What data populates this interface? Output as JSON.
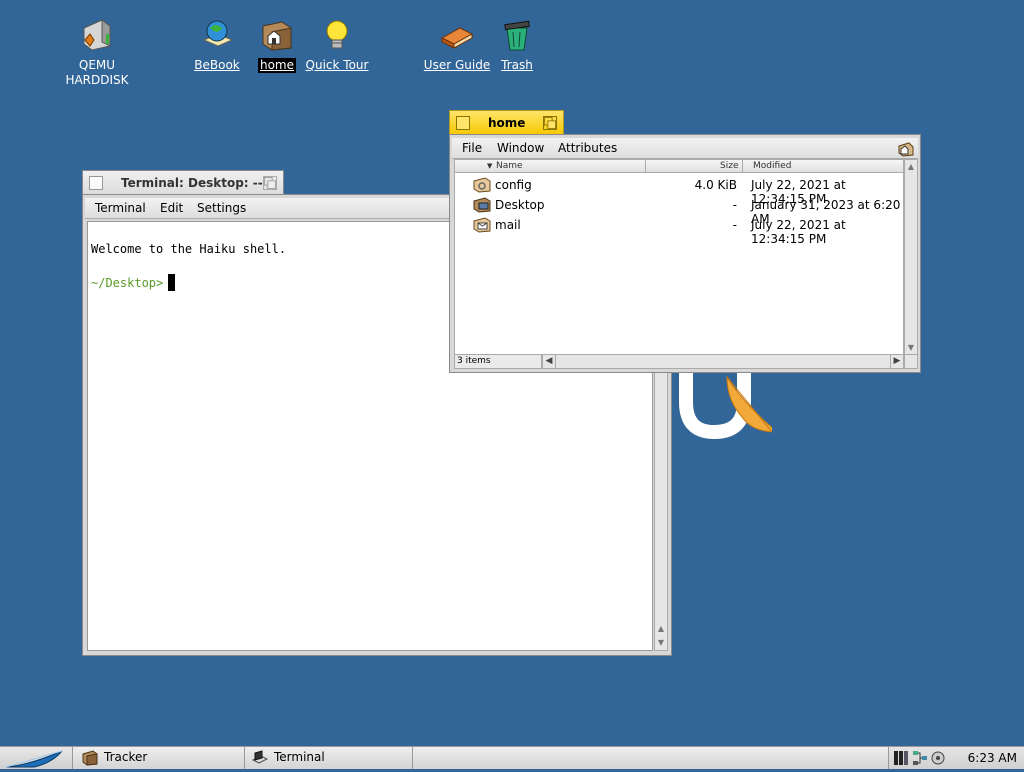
{
  "desktop": {
    "icons": [
      {
        "label": "QEMU HARDDISK",
        "icon": "harddisk-icon"
      },
      {
        "label": "BeBook",
        "icon": "bebook-icon"
      },
      {
        "label": "home",
        "icon": "home-folder-icon"
      },
      {
        "label": "Quick Tour",
        "icon": "lightbulb-icon"
      },
      {
        "label": "User Guide",
        "icon": "book-icon"
      },
      {
        "label": "Trash",
        "icon": "trash-icon"
      }
    ]
  },
  "terminal": {
    "title": "Terminal: Desktop: --",
    "menu": [
      "Terminal",
      "Edit",
      "Settings"
    ],
    "welcome": "Welcome to the Haiku shell.",
    "prompt": "~/Desktop>"
  },
  "home_window": {
    "title": "home",
    "menu": [
      "File",
      "Window",
      "Attributes"
    ],
    "columns": {
      "name": "Name",
      "size": "Size",
      "modified": "Modified"
    },
    "files": [
      {
        "name": "config",
        "size": "4.0 KiB",
        "modified": "July 22, 2021 at 12:34:15 PM",
        "icon": "config-folder-icon"
      },
      {
        "name": "Desktop",
        "size": "-",
        "modified": "January 31, 2023 at 6:20 AM",
        "icon": "desktop-folder-icon"
      },
      {
        "name": "mail",
        "size": "-",
        "modified": "July 22, 2021 at 12:34:15 PM",
        "icon": "mail-folder-icon"
      }
    ],
    "status": "3 items"
  },
  "deskbar": {
    "tasks": [
      {
        "label": "Tracker",
        "icon": "tracker-icon"
      },
      {
        "label": "Terminal",
        "icon": "terminal-icon"
      }
    ],
    "clock": "6:23 AM"
  },
  "colors": {
    "desktop_bg": "#336698",
    "active_tab": "#f6c800",
    "prompt_green": "#5a9a2a"
  }
}
